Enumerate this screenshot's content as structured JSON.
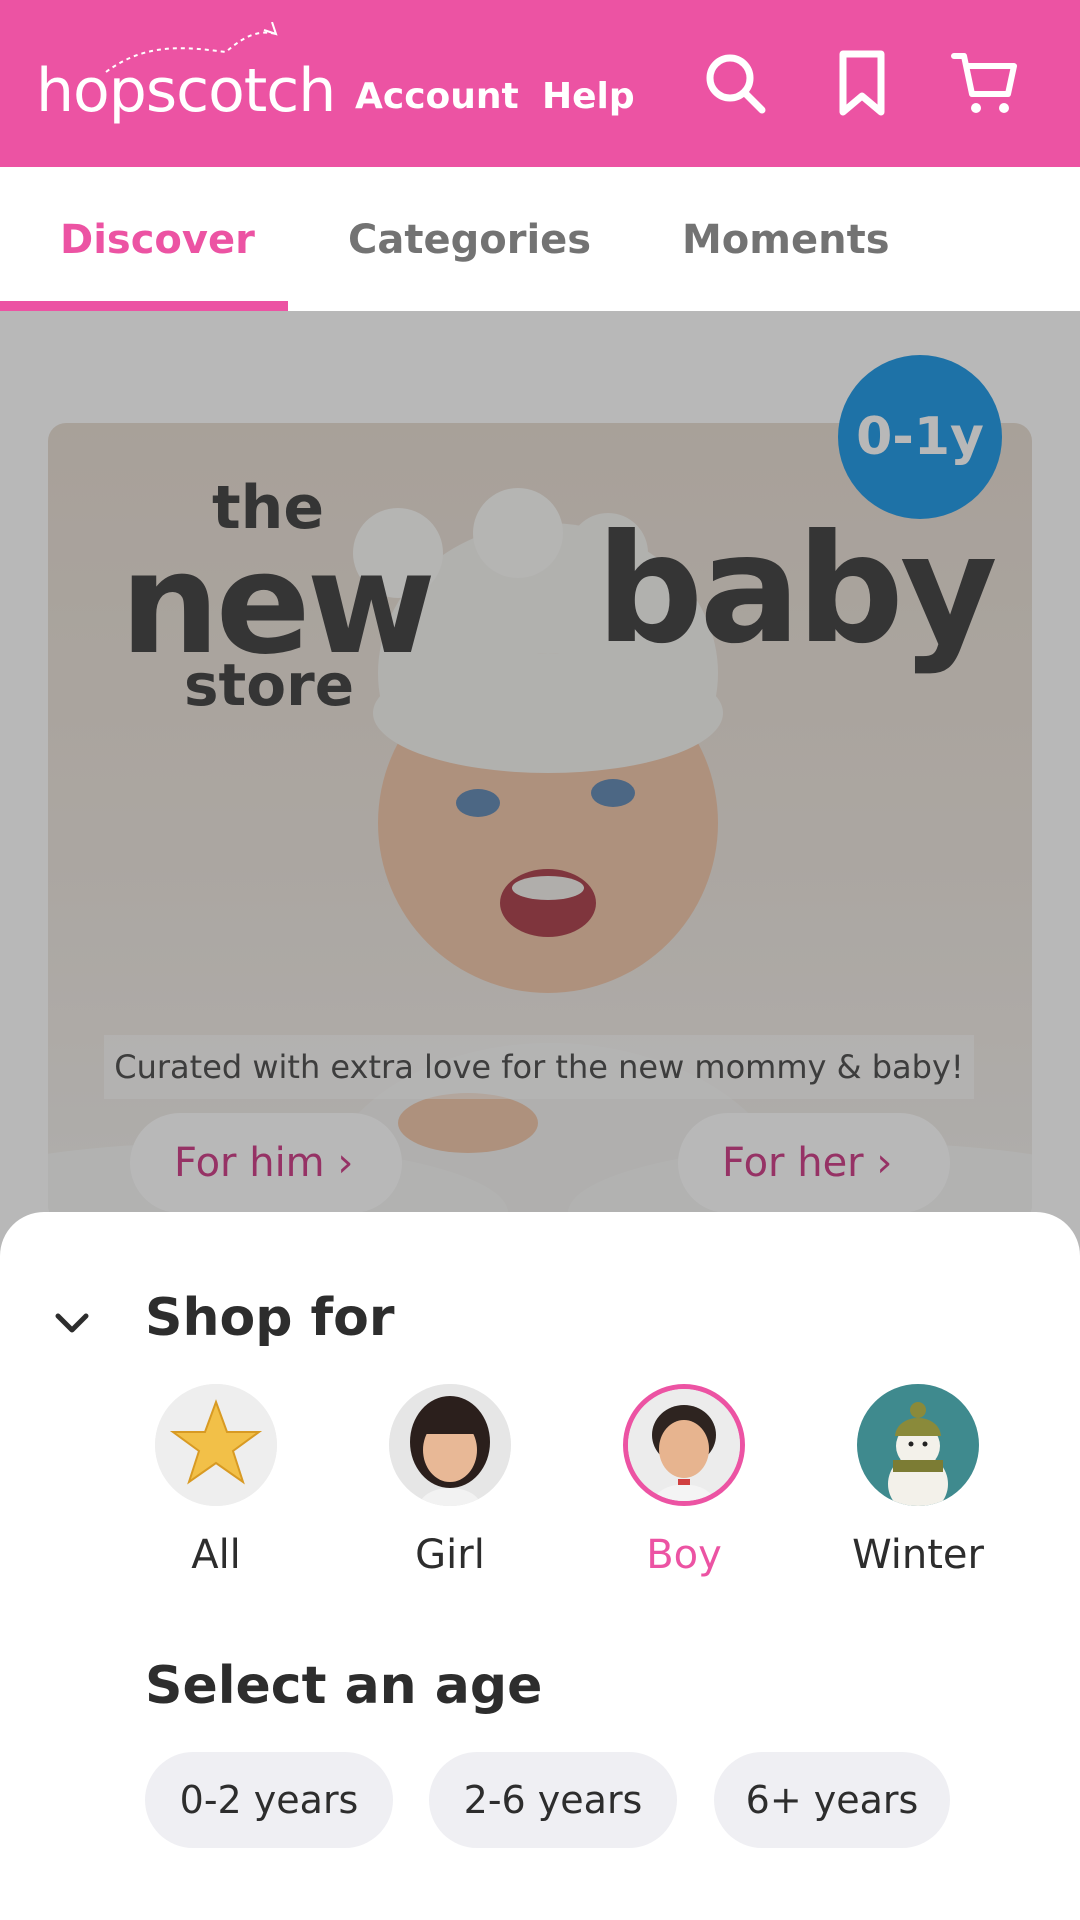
{
  "header": {
    "logo_text": "hopscotch",
    "nav": {
      "account": "Account",
      "help": "Help"
    },
    "icons": [
      "search-icon",
      "bookmark-icon",
      "cart-icon"
    ],
    "brand_color": "#ec53a3"
  },
  "tabs": [
    {
      "label": "Discover",
      "active": true
    },
    {
      "label": "Categories",
      "active": false
    },
    {
      "label": "Moments",
      "active": false
    }
  ],
  "banner": {
    "title_the": "the",
    "title_new": "new",
    "title_baby": "baby",
    "title_store": "store",
    "age_badge": "0-1y",
    "caption": "Curated with extra love for the new mommy & baby!",
    "buttons": {
      "him": "For him ›",
      "her": "For her ›"
    }
  },
  "sheet": {
    "title": "Shop for",
    "options": [
      {
        "label": "All",
        "icon": "star-icon",
        "selected": false
      },
      {
        "label": "Girl",
        "icon": "girl-avatar",
        "selected": false
      },
      {
        "label": "Boy",
        "icon": "boy-avatar",
        "selected": true
      },
      {
        "label": "Winter",
        "icon": "snowman-icon",
        "selected": false
      }
    ],
    "age_title": "Select an age",
    "ages": [
      "0-2 years",
      "2-6 years",
      "6+ years"
    ]
  }
}
